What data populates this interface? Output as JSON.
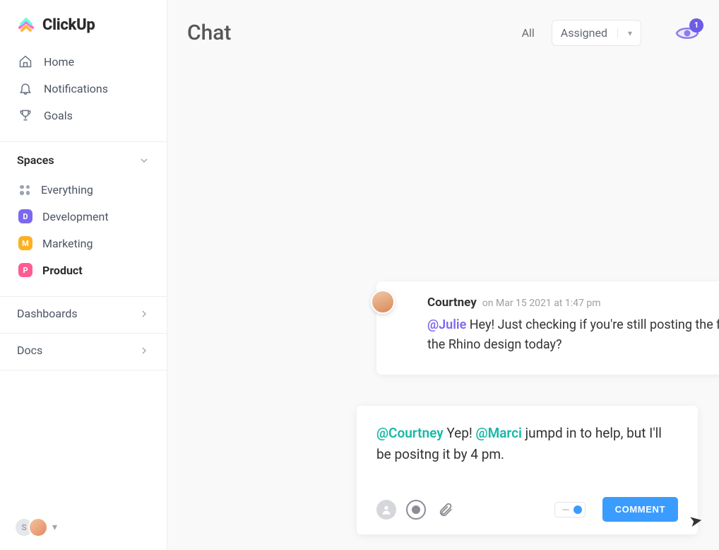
{
  "brand": {
    "name": "ClickUp"
  },
  "nav": {
    "home": "Home",
    "notifications": "Notifications",
    "goals": "Goals"
  },
  "spaces": {
    "header": "Spaces",
    "everything": "Everything",
    "items": [
      {
        "label": "Development",
        "letter": "D",
        "color": "#7b68ee"
      },
      {
        "label": "Marketing",
        "letter": "M",
        "color": "#ffb020"
      },
      {
        "label": "Product",
        "letter": "P",
        "color": "#ff5c93",
        "active": true
      }
    ]
  },
  "sections": {
    "dashboards": "Dashboards",
    "docs": "Docs"
  },
  "footer": {
    "initial": "S"
  },
  "chat": {
    "title": "Chat",
    "filter_all": "All",
    "filter_assigned": "Assigned",
    "watchers_count": "1"
  },
  "messages": [
    {
      "author": "Courtney",
      "timestamp": "on Mar 15 2021 at 1:47 pm",
      "mention": "@Julie",
      "body_rest": " Hey! Just checking if you're still posting the final version of the Rhino design today?"
    }
  ],
  "composer": {
    "mention1": "@Courtney",
    "segment1": " Yep! ",
    "mention2": "@Marci",
    "segment2": " jumpd in to help, but I'll be positng it by 4 pm.",
    "button": "COMMENT"
  }
}
